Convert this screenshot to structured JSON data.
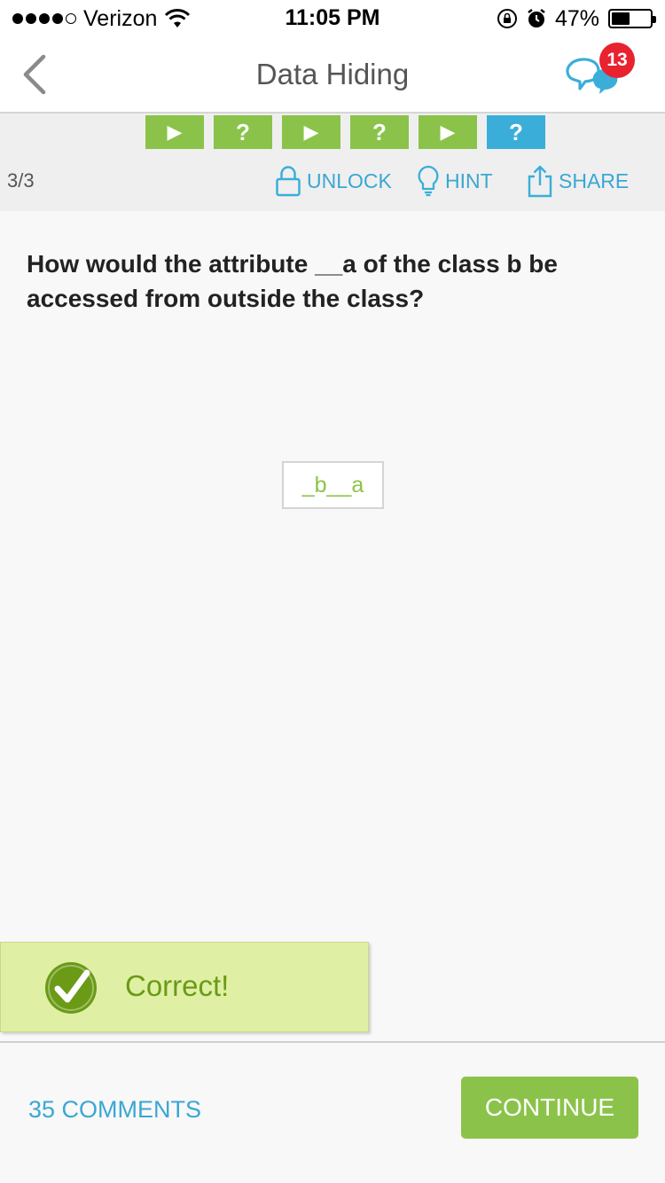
{
  "status_bar": {
    "carrier": "Verizon",
    "time": "11:05 PM",
    "battery": "47%",
    "battery_level": 0.47,
    "signal_dots_filled": 4,
    "icons": [
      "wifi-icon",
      "orientation-lock-icon",
      "alarm-icon",
      "battery-icon"
    ]
  },
  "nav": {
    "title": "Data Hiding",
    "back_icon": "chevron-left-icon",
    "chat_icon": "chat-bubbles-icon",
    "notification_count": "13"
  },
  "progress": {
    "steps": [
      {
        "type": "play",
        "symbol": "▶",
        "state": "completed"
      },
      {
        "type": "quiz",
        "symbol": "?",
        "state": "completed"
      },
      {
        "type": "play",
        "symbol": "▶",
        "state": "completed"
      },
      {
        "type": "quiz",
        "symbol": "?",
        "state": "completed"
      },
      {
        "type": "play",
        "symbol": "▶",
        "state": "completed"
      },
      {
        "type": "quiz",
        "symbol": "?",
        "state": "current"
      }
    ]
  },
  "toolbar": {
    "counter": "3/3",
    "unlock_label": "UNLOCK",
    "hint_label": "HINT",
    "share_label": "SHARE"
  },
  "question": {
    "text": "How would the attribute __a of the class b be accessed from outside the class?",
    "answer": "_b__a"
  },
  "result": {
    "message": "Correct!"
  },
  "footer": {
    "comments_label": "35 COMMENTS",
    "continue_label": "CONTINUE"
  },
  "colors": {
    "green": "#8bc34a",
    "blue": "#3aaed8",
    "badge_red": "#e8222f",
    "correct_bg": "#dff0a5",
    "correct_text": "#6a9a16"
  }
}
